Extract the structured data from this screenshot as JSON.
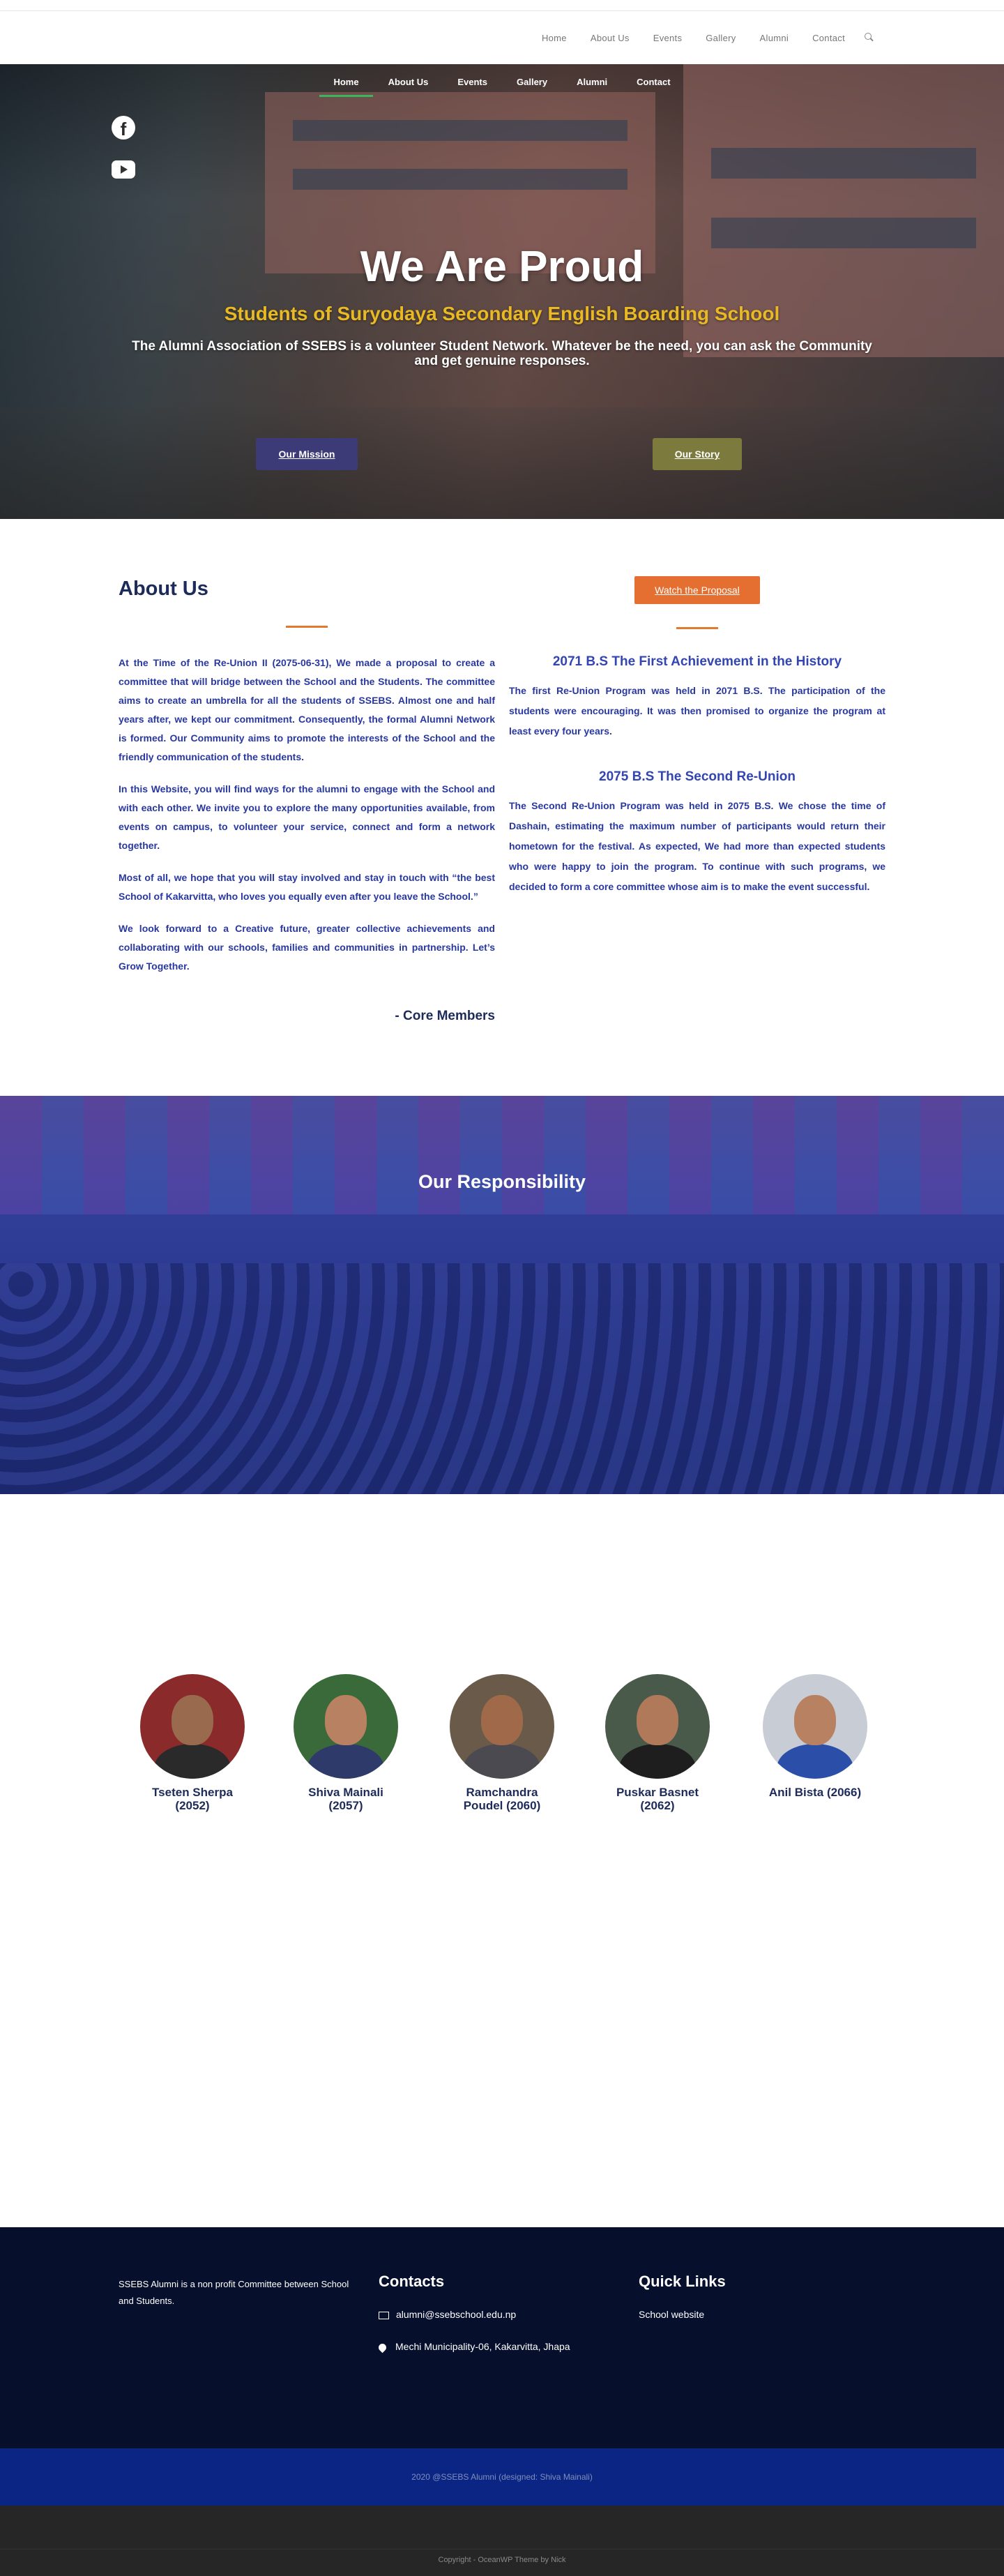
{
  "header": {
    "nav": [
      "Home",
      "About Us",
      "Events",
      "Gallery",
      "Alumni",
      "Contact"
    ]
  },
  "hero": {
    "nav": [
      "Home",
      "About Us",
      "Events",
      "Gallery",
      "Alumni",
      "Contact"
    ],
    "active": "Home",
    "title": "We Are Proud",
    "subtitle": "Students of Suryodaya Secondary English Boarding School",
    "description": "The Alumni Association of SSEBS  is a volunteer  Student Network. Whatever be the need, you can ask the Community and get genuine responses.",
    "mission_button": "Our Mission",
    "story_button": "Our Story"
  },
  "about": {
    "title": "About Us",
    "proposal_button": "Watch the Proposal",
    "paragraphs": [
      "At the Time of the Re-Union II (2075-06-31), We made a proposal to create a committee that will bridge between the School and the Students. The committee aims to create an umbrella for all the students of SSEBS. Almost one and half years after, we kept our commitment. Consequently, the formal Alumni Network is formed. Our Community aims to promote the interests of the School and the friendly communication of the students.",
      "In this Website, you will find ways for the alumni to engage with the School and with each other. We invite you to explore the many opportunities available, from events on campus, to volunteer your service, connect and form a network together.",
      "Most of all, we hope that you will stay involved and stay in touch with “the best School of Kakarvitta, who loves you equally even after you leave the School.”",
      "We look forward to a Creative future, greater collective achievements and collaborating with our schools, families and communities in partnership. Let’s Grow Together."
    ],
    "signature": "- Core Members",
    "history": [
      {
        "heading": "2071 B.S The First Achievement in the History",
        "text": "The first Re-Union Program was held in 2071 B.S. The participation of the students were encouraging. It was then promised to organize the program at least every four years."
      },
      {
        "heading": "2075 B.S The Second Re-Union",
        "text": "The Second Re-Union Program was held in 2075 B.S. We chose the time of Dashain, estimating the maximum number of participants would return their hometown for the festival.  As expected, We had more than expected students who were happy to join the program. To continue with such programs, we decided to form a core committee whose aim is to make the event successful."
      }
    ]
  },
  "responsibility": {
    "title": "Our Responsibility"
  },
  "team": [
    {
      "name": "Tseten Sherpa (2052)",
      "colors": {
        "bg": "#8a2a2a",
        "face": "#9a6a4e",
        "body": "#2a2a2a"
      }
    },
    {
      "name": "Shiva Mainali (2057)",
      "colors": {
        "bg": "#3b6a3a",
        "face": "#b88262",
        "body": "#2e3a6a"
      }
    },
    {
      "name": "Ramchandra Poudel (2060)",
      "colors": {
        "bg": "#6a5a4a",
        "face": "#a06a4a",
        "body": "#4a4a50"
      }
    },
    {
      "name": "Puskar Basnet (2062)",
      "colors": {
        "bg": "#4a5a4a",
        "face": "#b07a5a",
        "body": "#1e1e1e"
      }
    },
    {
      "name": "Anil Bista (2066)",
      "colors": {
        "bg": "#c8ccd4",
        "face": "#b88262",
        "body": "#2b4fa8"
      }
    }
  ],
  "footer": {
    "about": "SSEBS Alumni is a non profit Committee between School and Students.",
    "contacts_title": "Contacts",
    "email": "alumni@ssebschool.edu.np",
    "address": "Mechi Municipality-06, Kakarvitta, Jhapa",
    "links_title": "Quick Links",
    "link": "School website",
    "copyright": "2020 @SSEBS Alumni  (designed: Shiva Mainali)",
    "theme": "Copyright - OceanWP Theme by Nick"
  }
}
